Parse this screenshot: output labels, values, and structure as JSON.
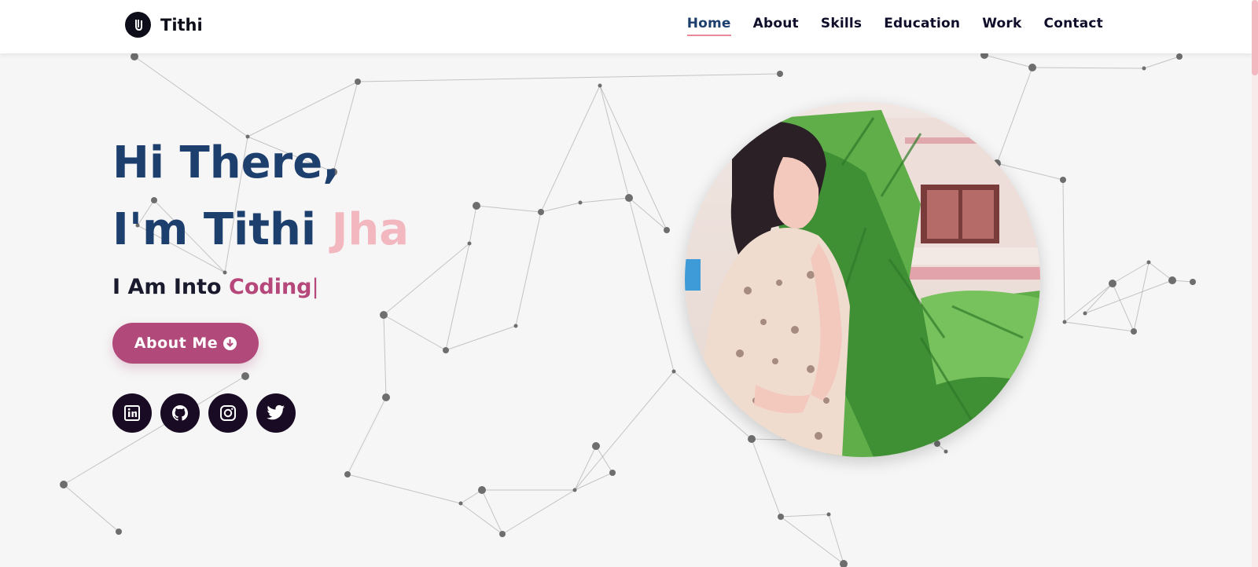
{
  "nav": {
    "brand": "Tithi",
    "items": [
      "Home",
      "About",
      "Skills",
      "Education",
      "Work",
      "Contact"
    ],
    "active": "Home"
  },
  "hero": {
    "greeting": "Hi There,",
    "name_prefix": "I'm Tithi ",
    "name_accent": "Jha",
    "sub_prefix": "I Am Into ",
    "sub_accent": "Coding",
    "cursor": "|",
    "button_label": "About Me"
  },
  "social": [
    "linkedin-icon",
    "github-icon",
    "instagram-icon",
    "twitter-icon"
  ],
  "colors": {
    "primary": "#1d3f6e",
    "accent_pink": "#f2b7bf",
    "accent_magenta": "#b5477a",
    "button": "#b14a7a",
    "dark": "#1a0b24",
    "background": "#f6f6f6"
  }
}
